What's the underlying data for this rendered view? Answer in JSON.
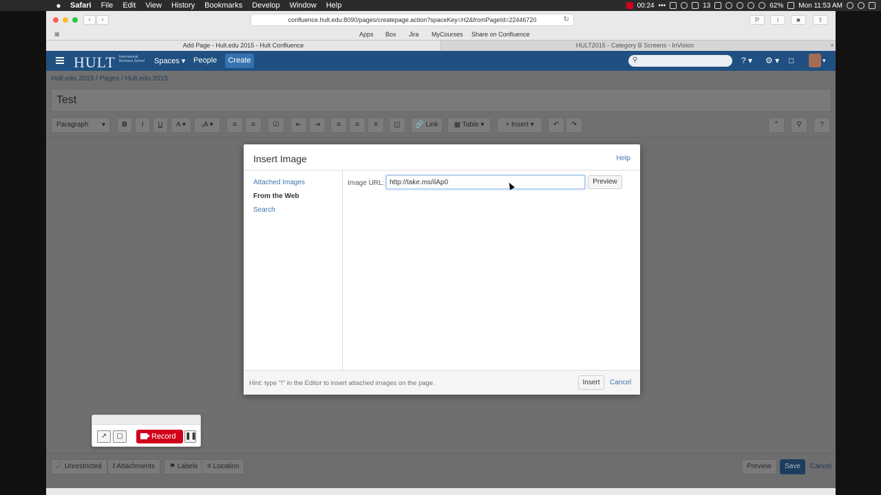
{
  "menubar": {
    "app": "Safari",
    "items": [
      "File",
      "Edit",
      "View",
      "History",
      "Bookmarks",
      "Develop",
      "Window",
      "Help"
    ],
    "recording_time": "00:24",
    "battery": "62%",
    "clock": "Mon 11:53 AM",
    "calendar_day": "13"
  },
  "browser": {
    "url": "confluence.hult.edu:8090/pages/createpage.action?spaceKey=H2&fromPageId=22446720",
    "favorites": [
      "Apps",
      "Box",
      "Jira",
      "MyCourses",
      "Share on Confluence"
    ],
    "tabs": [
      {
        "label": "Add Page - Hult.edu 2015 - Hult Confluence"
      },
      {
        "label": "HULT2015 - Category B Screens - InVision"
      }
    ]
  },
  "header": {
    "logo": "HULT",
    "logo_sub": "International Business School",
    "spaces": "Spaces",
    "people": "People",
    "create": "Create"
  },
  "breadcrumb": [
    "Hult.edu 2015",
    "Pages",
    "Hult.edu 2015"
  ],
  "page_title": "Test",
  "editor_toolbar": {
    "paragraph": "Paragraph",
    "bold": "B",
    "italic": "I",
    "underline": "U",
    "color": "A",
    "link": "Link",
    "table": "Table",
    "insert": "Insert"
  },
  "bottom_bar": {
    "unrestricted": "Unrestricted",
    "attachments": "Attachments",
    "labels": "Labels",
    "location": "Location",
    "preview": "Preview",
    "save": "Save",
    "cancel": "Cancel"
  },
  "dialog": {
    "title": "Insert Image",
    "help": "Help",
    "sidebar": [
      "Attached Images",
      "From the Web",
      "Search"
    ],
    "active_sidebar": "From the Web",
    "url_label": "Image URL:",
    "url_value": "http://take.ms/ilAp0",
    "preview": "Preview",
    "hint": "Hint: type \"!\" in the Editor to insert attached images on the page.",
    "insert": "Insert",
    "cancel": "Cancel"
  },
  "recorder": {
    "record": "Record"
  },
  "colors": {
    "confluence_header": "#205081",
    "link": "#3b73af",
    "record_red": "#d0021b"
  }
}
